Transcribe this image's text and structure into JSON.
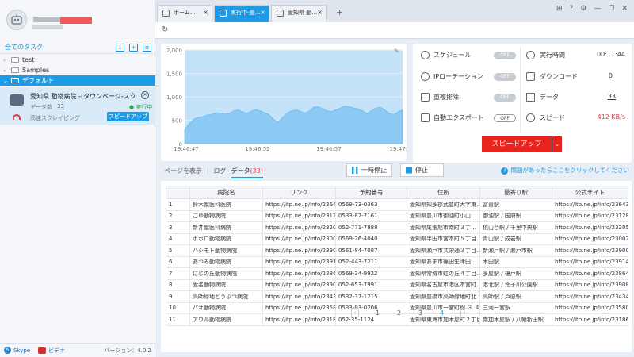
{
  "sidebar": {
    "tasks_header": "全てのタスク",
    "tree": [
      {
        "label": "test"
      },
      {
        "label": "Samples"
      },
      {
        "label": "デフォルト"
      }
    ],
    "task": {
      "name": "愛知県 動物病院 -(タウンページ-スクレイ…",
      "data_label": "データ数",
      "data_count": "33",
      "status": "● 実行中",
      "mode": "高速スクレイピング",
      "speedup": "スピードアップ"
    },
    "footer": {
      "skype": "Skype",
      "video": "ビデオ",
      "version": "バージョン：4.0.2"
    }
  },
  "tabs": [
    {
      "label": "ホーム…",
      "active": false
    },
    {
      "label": "実行中-愛…",
      "active": true
    },
    {
      "label": "愛知県 動…",
      "active": false
    }
  ],
  "chart_data": {
    "type": "area",
    "x_ticks": [
      "19:46:47",
      "19:46:52",
      "19:46:57",
      "19:47:2"
    ],
    "y_ticks": [
      "0",
      "500",
      "1,000",
      "1,500",
      "2,000"
    ],
    "ylim": [
      0,
      2000
    ],
    "values": [
      300,
      420,
      520,
      560,
      570,
      610,
      620,
      660,
      650,
      630,
      640,
      700,
      720,
      680,
      650,
      690,
      730,
      700,
      660,
      620,
      520,
      460,
      560,
      650,
      700,
      720,
      690,
      650,
      690,
      780,
      790,
      750,
      700,
      680,
      720,
      760,
      800,
      790,
      760,
      740,
      700,
      640,
      700,
      760,
      780,
      720,
      640,
      620,
      680,
      720
    ]
  },
  "stats": {
    "schedule": {
      "label": "スケジュール",
      "value": "OFF"
    },
    "ip_rotation": {
      "label": "IPローテーション",
      "value": "OFF"
    },
    "dedupe": {
      "label": "重複排除",
      "value": "OFF"
    },
    "auto_export": {
      "label": "自動エクスポート",
      "value": "OFF"
    },
    "runtime": {
      "label": "実行時間",
      "value": "00:11:44"
    },
    "download": {
      "label": "ダウンロード",
      "value": "0"
    },
    "data": {
      "label": "データ",
      "value": "33"
    },
    "speed": {
      "label": "スピード",
      "value": "412 KB/s"
    },
    "speedup_button": "スピードアップ"
  },
  "view_tabs": {
    "page": "ページを表示",
    "log": "ログ",
    "data": "データ",
    "data_count": "(33)"
  },
  "controls": {
    "pause": "一時停止",
    "stop": "停止",
    "help": "問題があったらここをクリックしてください"
  },
  "table": {
    "headers": [
      "",
      "病院名",
      "リンク",
      "予約番号",
      "住所",
      "最寄り駅",
      "公式サイト"
    ],
    "rows": [
      [
        "1",
        "鈴木獣医科医院",
        "https://itp.ne.jp/info/236430…",
        "0569-73-0363",
        "愛知県知多郡武豊町大字東…",
        "富貴駅",
        "https://itp.ne.jp/info/236430…"
      ],
      [
        "2",
        "ごゆ動物病院",
        "https://itp.ne.jp/info/231280…",
        "0533-87-7161",
        "愛知県豊川市御油町小山…",
        "御油駅 / 国府駅",
        "https://itp.ne.jp/info/231280…"
      ],
      [
        "3",
        "新井獣医科病院",
        "https://itp.ne.jp/info/232058…",
        "052-771-7888",
        "愛知県尾張旭市南町３丁…",
        "桃山台駅 / 千里中央駅",
        "https://itp.ne.jp/info/232058…"
      ],
      [
        "4",
        "ポポロ動物病院",
        "https://itp.ne.jp/info/230026…",
        "0569-26-4040",
        "愛知県半田市宮本町５丁目…",
        "青山駅 / 成岩駅",
        "https://itp.ne.jp/info/230026…"
      ],
      [
        "5",
        "ハシモト動物病院",
        "https://itp.ne.jp/info/239001…",
        "0561-84-7087",
        "愛知県瀬戸市共栄通３丁目…",
        "新瀬戸駅 / 瀬戸市駅",
        "https://itp.ne.jp/info/239001…"
      ],
      [
        "6",
        "あつみ動物病院",
        "https://itp.ne.jp/info/239148…",
        "052-443-7211",
        "愛知県あま市篠田生津田…",
        "木田駅",
        "https://itp.ne.jp/info/239148…"
      ],
      [
        "7",
        "にじの丘動物病院",
        "https://itp.ne.jp/info/238641…",
        "0569-34-9922",
        "愛知県常滑市虹の丘４丁目…",
        "多屋駅 / 榎戸駅",
        "https://itp.ne.jp/info/238641…"
      ],
      [
        "8",
        "愛名動物病院",
        "https://itp.ne.jp/info/239085…",
        "052-653-7991",
        "愛知県名古屋市港区本宮町…",
        "港北駅 / 荒子川公園駅",
        "https://itp.ne.jp/info/239085…"
      ],
      [
        "9",
        "高師緑地どうぶつ病院",
        "https://itp.ne.jp/info/234345…",
        "0532-37-1215",
        "愛知県豊橋市高師緑地町北…",
        "高師駅 / 芦原駅",
        "https://itp.ne.jp/info/234345…"
      ],
      [
        "10",
        "パオ動物病院",
        "https://itp.ne.jp/info/235805…",
        "0533-93-0206",
        "愛知県豊川市一宮町錦 ３ ４",
        "三河一宮駅",
        "https://itp.ne.jp/info/235805…"
      ],
      [
        "11",
        "アウル動物病院",
        "https://itp.ne.jp/info/231866…",
        "052-35-1124",
        "愛知県東海市加木屋町２丁目…",
        "南加木屋駅 / 八幡新田駅",
        "https://itp.ne.jp/info/231866…"
      ]
    ]
  },
  "pager": {
    "pages": [
      "1",
      "2",
      "3",
      "4"
    ],
    "current": "4",
    "prev": "‹",
    "next": "›"
  }
}
